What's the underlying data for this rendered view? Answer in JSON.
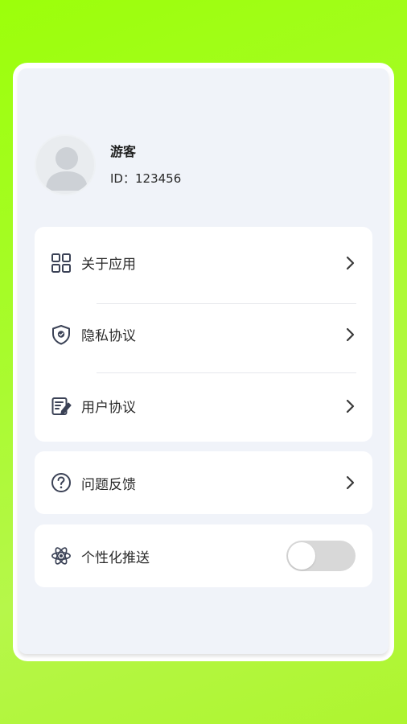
{
  "profile": {
    "name": "游客",
    "id_label": "ID：",
    "id_value": "123456"
  },
  "menu": {
    "about": {
      "label": "关于应用",
      "icon": "grid-apps-icon"
    },
    "privacy": {
      "label": "隐私协议",
      "icon": "shield-check-icon"
    },
    "user_agreement": {
      "label": "用户协议",
      "icon": "document-edit-icon"
    },
    "feedback": {
      "label": "问题反馈",
      "icon": "question-circle-icon"
    },
    "push": {
      "label": "个性化推送",
      "icon": "atom-icon",
      "enabled": false
    }
  },
  "colors": {
    "background": "#a8fb2c",
    "card": "#f0f3f9",
    "icon": "#3b4256",
    "toggle_off": "#d8d8d8"
  }
}
